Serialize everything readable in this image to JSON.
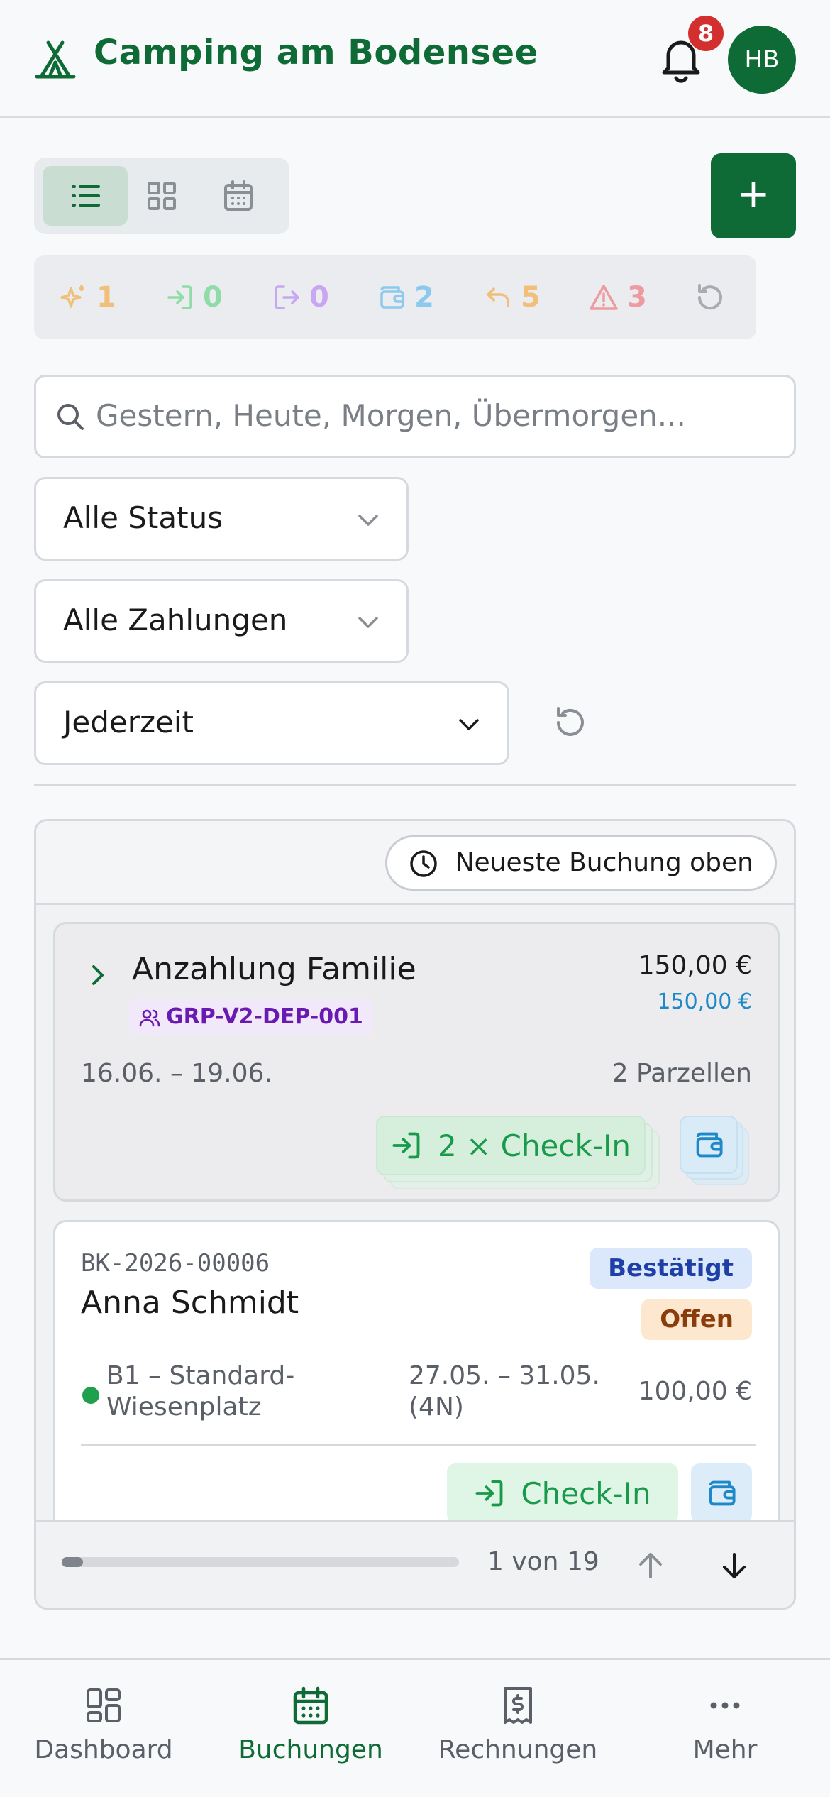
{
  "header": {
    "app_title": "Camping am Bodensee",
    "notification_count": "8",
    "avatar_initials": "HB",
    "logo_icon": "tent-icon",
    "bell_icon": "bell-icon"
  },
  "toolbar": {
    "view_modes": [
      {
        "name": "list",
        "icon": "list-icon",
        "active": true
      },
      {
        "name": "grid",
        "icon": "grid-icon",
        "active": false
      },
      {
        "name": "calendar",
        "icon": "calendar-icon",
        "active": false
      }
    ],
    "add_label": "+"
  },
  "stats": [
    {
      "icon": "sparkles-icon",
      "value": "1",
      "color": "#f0bf79"
    },
    {
      "icon": "check-in-icon",
      "value": "0",
      "color": "#8fdca7"
    },
    {
      "icon": "check-out-icon",
      "value": "0",
      "color": "#c9a6f2"
    },
    {
      "icon": "wallet-icon",
      "value": "2",
      "color": "#8cc9ec"
    },
    {
      "icon": "undo-icon",
      "value": "5",
      "color": "#f0bf79"
    },
    {
      "icon": "warning-icon",
      "value": "3",
      "color": "#ee9ba0"
    }
  ],
  "filters": {
    "search_placeholder": "Gestern, Heute, Morgen, Übermorgen...",
    "status_value": "Alle Status",
    "payment_value": "Alle Zahlungen",
    "time_value": "Jederzeit"
  },
  "list": {
    "sort_label": "Neueste Buchung oben",
    "group_card": {
      "title": "Anzahlung Familie",
      "group_code": "GRP-V2-DEP-001",
      "total": "150,00 €",
      "paid": "150,00 €",
      "dates": "16.06. – 19.06.",
      "pitches": "2 Parzellen",
      "checkin_label": "2 × Check-In"
    },
    "booking_card": {
      "booking_id": "BK-2026-00006",
      "guest": "Anna Schmidt",
      "status": "Bestätigt",
      "payment_status": "Offen",
      "pitch_line1": "B1 – Standard-",
      "pitch_line2": "Wiesenplatz",
      "dates_line1": "27.05. – 31.05.",
      "dates_line2": "(4N)",
      "amount": "100,00 €",
      "checkin_label": "Check-In"
    },
    "pagination": {
      "text": "1 von 19",
      "progress": 0.053
    }
  },
  "bottom_nav": [
    {
      "label": "Dashboard",
      "icon": "dashboard-icon",
      "active": false
    },
    {
      "label": "Buchungen",
      "icon": "calendar-icon",
      "active": true
    },
    {
      "label": "Rechnungen",
      "icon": "receipt-icon",
      "active": false
    },
    {
      "label": "Mehr",
      "icon": "more-icon",
      "active": false
    }
  ],
  "colors": {
    "brand": "#0e6b35",
    "badge_red": "#d32f2f",
    "checkin_green": "#189a4a",
    "wallet_blue": "#1e88c8",
    "group_purple": "#6a1ab0"
  }
}
